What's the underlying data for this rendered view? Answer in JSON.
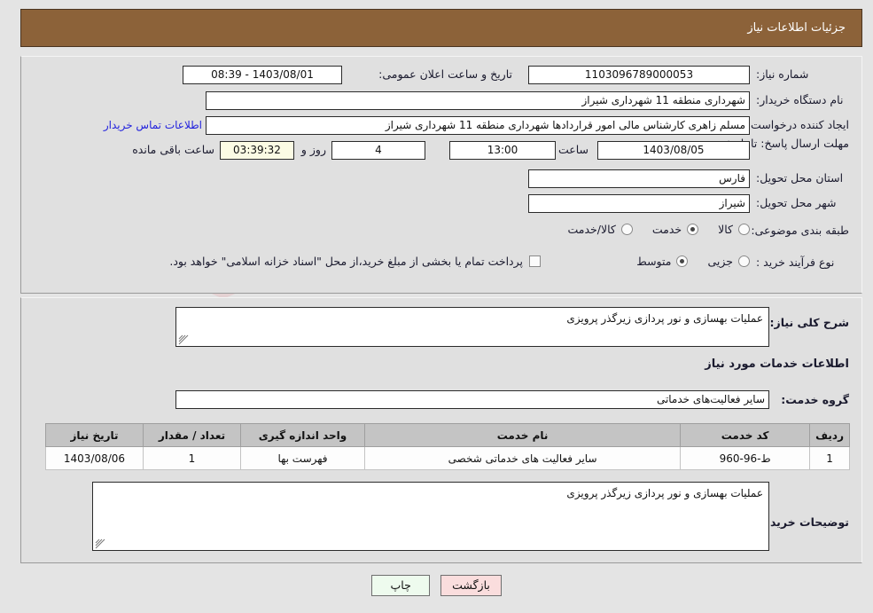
{
  "header": {
    "title": "جزئیات اطلاعات نیاز",
    "bg_color": "#8c6239",
    "text_color": "#ffffff"
  },
  "top_section": {
    "need_number": {
      "label": "شماره نیاز:",
      "value": "1103096789000053"
    },
    "announce_datetime": {
      "label": "تاریخ و ساعت اعلان عمومی:",
      "value": "1403/08/01 - 08:39"
    },
    "buyer_org": {
      "label": "نام دستگاه خریدار:",
      "value": "شهرداری منطقه 11 شهرداری شیراز"
    },
    "creator": {
      "label": "ایجاد کننده درخواست:",
      "value": "مسلم زاهری کارشناس مالی امور قراردادها شهرداری منطقه 11 شهرداری شیراز",
      "contact_link": "اطلاعات تماس خریدار"
    },
    "deadline": {
      "label": "مهلت ارسال پاسخ: تا تاریخ:",
      "date": "1403/08/05",
      "time_label": "ساعت",
      "time": "13:00",
      "days": "4",
      "days_label": "روز و",
      "countdown": "03:39:32",
      "countdown_label": "ساعت باقی مانده"
    },
    "province": {
      "label": "استان محل تحویل:",
      "value": "فارس"
    },
    "city": {
      "label": "شهر محل تحویل:",
      "value": "شیراز"
    },
    "category": {
      "label": "طبقه بندی موضوعی:",
      "options": [
        {
          "label": "کالا",
          "selected": false
        },
        {
          "label": "خدمت",
          "selected": true
        },
        {
          "label": "کالا/خدمت",
          "selected": false
        }
      ]
    },
    "purchase_type": {
      "label": "نوع فرآیند خرید :",
      "options": [
        {
          "label": "جزیی",
          "selected": false
        },
        {
          "label": "متوسط",
          "selected": true
        }
      ],
      "treasury_checkbox": {
        "checked": false,
        "text": "پرداخت تمام یا بخشی از مبلغ خرید،از محل \"اسناد خزانه اسلامی\" خواهد بود."
      }
    }
  },
  "mid_section": {
    "general_desc": {
      "label": "شرح کلی نیاز:",
      "value": "عملیات بهسازی و نور پردازی زیرگذر پرویزی"
    },
    "services_heading": "اطلاعات خدمات مورد نیاز",
    "service_group": {
      "label": "گروه خدمت:",
      "value": "سایر فعالیت‌های خدماتی"
    },
    "table": {
      "headers": [
        "ردیف",
        "کد خدمت",
        "نام خدمت",
        "واحد اندازه گیری",
        "تعداد / مقدار",
        "تاریخ نیاز"
      ],
      "rows": [
        {
          "row_no": "1",
          "service_code": "ط-96-960",
          "service_name": "سایر فعالیت های خدماتی شخصی",
          "unit": "فهرست بها",
          "quantity": "1",
          "need_date": "1403/08/06"
        }
      ]
    },
    "buyer_notes": {
      "label": "توضیحات خریدار:",
      "value": "عملیات بهسازی و نور پردازی زیرگذر پرویزی"
    }
  },
  "footer": {
    "print_button": "چاپ",
    "back_button": "بازگشت"
  },
  "watermark": {
    "text": "ArtaTender.net"
  }
}
